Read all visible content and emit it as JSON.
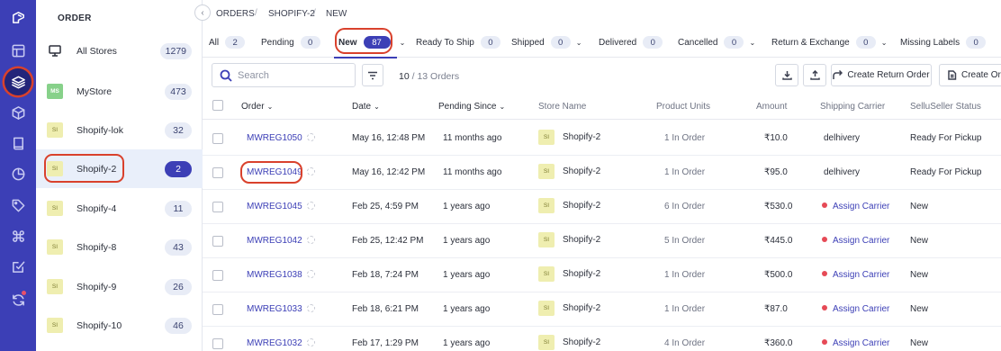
{
  "rail": {
    "icons": [
      "logo-icon",
      "layout-icon",
      "layers-icon",
      "box-icon",
      "book-icon",
      "pie-chart-icon",
      "tag-icon",
      "command-icon",
      "check-square-icon",
      "refresh-icon"
    ]
  },
  "stores_panel": {
    "title": "ORDER",
    "stores": [
      {
        "icon": "",
        "name": "All Stores",
        "count": "1279"
      },
      {
        "icon": "MS",
        "name": "MyStore",
        "count": "473"
      },
      {
        "icon": "SI",
        "name": "Shopify-lok",
        "count": "32"
      },
      {
        "icon": "SI",
        "name": "Shopify-2",
        "count": "2"
      },
      {
        "icon": "SI",
        "name": "Shopify-4",
        "count": "11"
      },
      {
        "icon": "SI",
        "name": "Shopify-8",
        "count": "43"
      },
      {
        "icon": "SI",
        "name": "Shopify-9",
        "count": "26"
      },
      {
        "icon": "SI",
        "name": "Shopify-10",
        "count": "46"
      }
    ]
  },
  "breadcrumb": {
    "items": [
      "ORDERS",
      "SHOPIFY-2",
      "NEW"
    ],
    "separator": "/"
  },
  "tabs": [
    {
      "label": "All",
      "count": "2"
    },
    {
      "label": "Pending",
      "count": "0"
    },
    {
      "label": "New",
      "count": "87"
    },
    {
      "label": "Ready To Ship",
      "count": "0"
    },
    {
      "label": "Shipped",
      "count": "0"
    },
    {
      "label": "Delivered",
      "count": "0"
    },
    {
      "label": "Cancelled",
      "count": "0"
    },
    {
      "label": "Return & Exchange",
      "count": "0"
    },
    {
      "label": "Missing Labels",
      "count": "0"
    }
  ],
  "toolbar": {
    "search_placeholder": "Search",
    "shown": "10",
    "total": "/ 13 Orders",
    "create_return_label": "Create Return Order",
    "create_order_label": "Create Orde"
  },
  "table": {
    "headers": {
      "order": "Order",
      "date": "Date",
      "pending_since": "Pending Since",
      "store": "Store Name",
      "units": "Product Units",
      "amount": "Amount",
      "carrier": "Shipping Carrier",
      "status": "SelluSeller Status"
    },
    "rows": [
      {
        "order": "MWREG1050",
        "date": "May 16, 12:48 PM",
        "pending": "11 months ago",
        "store_icon": "SI",
        "store": "Shopify-2",
        "units": "1 In Order",
        "amount": "₹10.0",
        "carrier": "delhivery",
        "status": "Ready For Pickup"
      },
      {
        "order": "MWREG1049",
        "date": "May 16, 12:42 PM",
        "pending": "11 months ago",
        "store_icon": "SI",
        "store": "Shopify-2",
        "units": "1 In Order",
        "amount": "₹95.0",
        "carrier": "delhivery",
        "status": "Ready For Pickup"
      },
      {
        "order": "MWREG1045",
        "date": "Feb 25, 4:59 PM",
        "pending": "1 years ago",
        "store_icon": "SI",
        "store": "Shopify-2",
        "units": "6 In Order",
        "amount": "₹530.0",
        "carrier": "Assign Carrier",
        "status": "New"
      },
      {
        "order": "MWREG1042",
        "date": "Feb 25, 12:42 PM",
        "pending": "1 years ago",
        "store_icon": "SI",
        "store": "Shopify-2",
        "units": "5 In Order",
        "amount": "₹445.0",
        "carrier": "Assign Carrier",
        "status": "New"
      },
      {
        "order": "MWREG1038",
        "date": "Feb 18, 7:24 PM",
        "pending": "1 years ago",
        "store_icon": "SI",
        "store": "Shopify-2",
        "units": "1 In Order",
        "amount": "₹500.0",
        "carrier": "Assign Carrier",
        "status": "New"
      },
      {
        "order": "MWREG1033",
        "date": "Feb 18, 6:21 PM",
        "pending": "1 years ago",
        "store_icon": "SI",
        "store": "Shopify-2",
        "units": "1 In Order",
        "amount": "₹87.0",
        "carrier": "Assign Carrier",
        "status": "New"
      },
      {
        "order": "MWREG1032",
        "date": "Feb 17, 1:29 PM",
        "pending": "1 years ago",
        "store_icon": "SI",
        "store": "Shopify-2",
        "units": "4 In Order",
        "amount": "₹360.0",
        "carrier": "Assign Carrier",
        "status": "New"
      }
    ]
  },
  "colors": {
    "accent": "#3c3fb6",
    "highlight": "#d9412c",
    "alert_dot": "#e64a56"
  }
}
